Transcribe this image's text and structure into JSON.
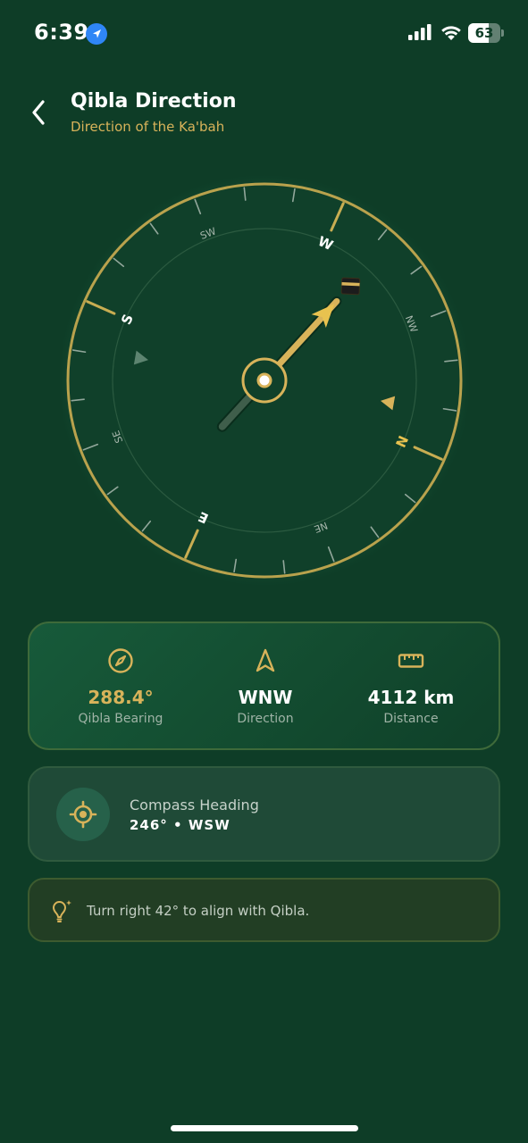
{
  "status_bar": {
    "time": "6:39",
    "battery": "63",
    "battery_level": 0.63,
    "icons": [
      "location-arrow-icon",
      "signal-bars-icon",
      "wifi-icon",
      "battery-icon"
    ]
  },
  "header": {
    "title": "Qibla Direction",
    "subtitle": "Direction of the Ka'bah",
    "back_icon": "chevron-left-icon"
  },
  "compass": {
    "heading_deg": 246,
    "qibla_bearing_deg": 288.4,
    "cardinals": [
      "N",
      "E",
      "S",
      "W"
    ],
    "intercardinals": [
      "NE",
      "SE",
      "SW",
      "NW"
    ],
    "kaaba_icon": "kaaba-icon",
    "colors": {
      "ring": "#b9a24d",
      "accent": "#d8b35a",
      "north_red": "#e8c24f",
      "dial": "#10402a"
    }
  },
  "info": {
    "bearing_value": "288.4°",
    "bearing_label": "Qibla Bearing",
    "direction_value": "WNW",
    "direction_label": "Direction",
    "distance_value": "4112 km",
    "distance_label": "Distance",
    "icons": [
      "compass-icon",
      "navigation-arrow-icon",
      "ruler-icon"
    ]
  },
  "heading": {
    "title": "Compass Heading",
    "value": "246° • WSW",
    "icon": "crosshair-icon"
  },
  "tip": {
    "text": "Turn right 42° to align with Qibla.",
    "icon": "lightbulb-icon"
  }
}
